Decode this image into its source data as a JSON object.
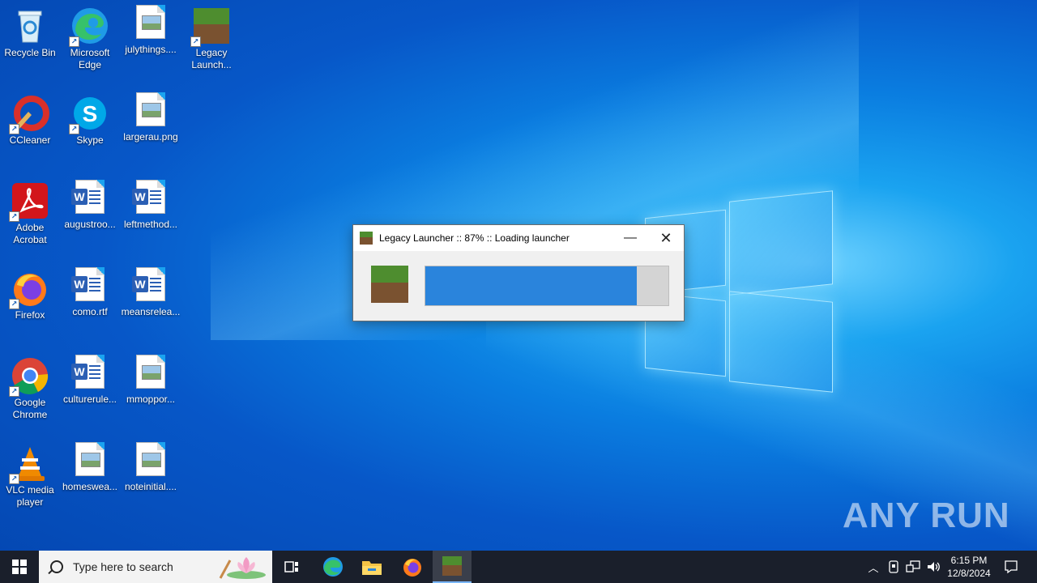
{
  "desktop": {
    "icons": [
      {
        "label": "Recycle Bin",
        "icon": "recycle-bin-icon"
      },
      {
        "label": "Microsoft Edge",
        "icon": "edge-icon"
      },
      {
        "label": "julythings....",
        "icon": "image-file-icon"
      },
      {
        "label": "Legacy Launch...",
        "icon": "minecraft-icon"
      },
      {
        "label": "CCleaner",
        "icon": "ccleaner-icon"
      },
      {
        "label": "Skype",
        "icon": "skype-icon"
      },
      {
        "label": "largerau.png",
        "icon": "image-file-icon"
      },
      {
        "label": "Adobe Acrobat",
        "icon": "acrobat-icon"
      },
      {
        "label": "augustroo...",
        "icon": "word-doc-icon"
      },
      {
        "label": "leftmethod...",
        "icon": "word-doc-icon"
      },
      {
        "label": "Firefox",
        "icon": "firefox-icon"
      },
      {
        "label": "como.rtf",
        "icon": "word-doc-icon"
      },
      {
        "label": "meansrelea...",
        "icon": "word-doc-icon"
      },
      {
        "label": "Google Chrome",
        "icon": "chrome-icon"
      },
      {
        "label": "culturerule...",
        "icon": "word-doc-icon"
      },
      {
        "label": "mmoppor...",
        "icon": "image-file-icon"
      },
      {
        "label": "VLC media player",
        "icon": "vlc-icon"
      },
      {
        "label": "homeswea...",
        "icon": "image-file-icon"
      },
      {
        "label": "noteinitial....",
        "icon": "image-file-icon"
      }
    ]
  },
  "dialog": {
    "title": "Legacy Launcher :: 87% :: Loading launcher",
    "progress": 0.87,
    "minimize_symbol": "—",
    "close_symbol": "✕"
  },
  "taskbar": {
    "search_placeholder": "Type here to search",
    "pinned": [
      "task-view-icon",
      "edge-icon",
      "file-explorer-icon",
      "firefox-icon",
      "minecraft-icon"
    ],
    "active_item": "minecraft-icon"
  },
  "tray": {
    "time": "6:15 PM",
    "date": "12/8/2024"
  },
  "watermark": "ANY RUN",
  "colors": {
    "progress_fill": "#2a84dc",
    "progress_track": "#d4d4d4",
    "taskbar": "#1a1f2b"
  }
}
